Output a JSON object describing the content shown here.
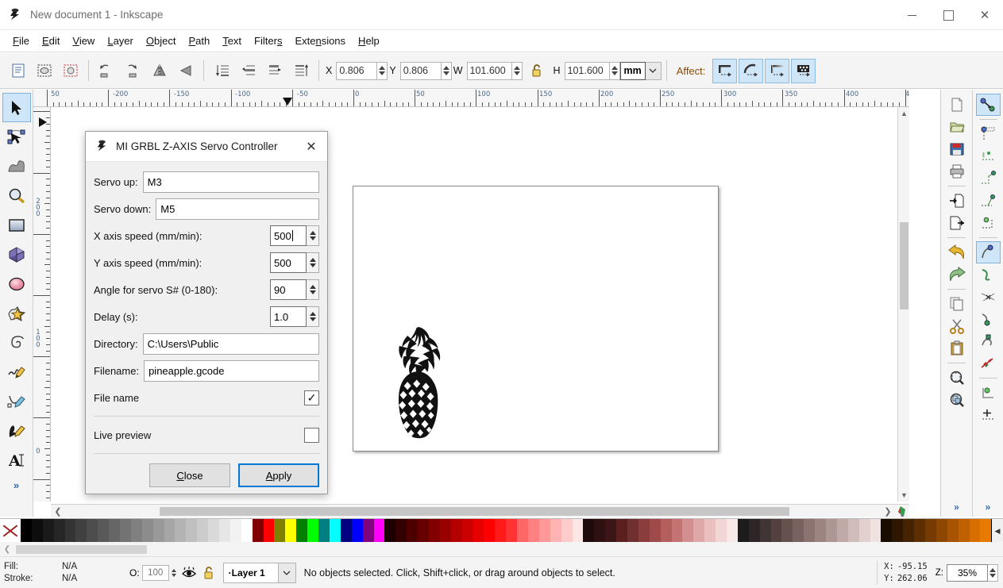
{
  "window": {
    "title": "New document 1 - Inkscape",
    "app_icon": "inkscape-logo-icon",
    "controls": {
      "minimize": "minimize-icon",
      "maximize": "maximize-icon",
      "close": "close-icon"
    }
  },
  "menubar": {
    "items": [
      {
        "label": "File",
        "mnemonic": "F"
      },
      {
        "label": "Edit",
        "mnemonic": "E"
      },
      {
        "label": "View",
        "mnemonic": "V"
      },
      {
        "label": "Layer",
        "mnemonic": "L"
      },
      {
        "label": "Object",
        "mnemonic": "O"
      },
      {
        "label": "Path",
        "mnemonic": "P"
      },
      {
        "label": "Text",
        "mnemonic": "T"
      },
      {
        "label": "Filters",
        "mnemonic": "s"
      },
      {
        "label": "Extensions",
        "mnemonic": "n"
      },
      {
        "label": "Help",
        "mnemonic": "H"
      }
    ]
  },
  "toolbar": {
    "x_label": "X",
    "x_value": "0.806",
    "y_label": "Y",
    "y_value": "0.806",
    "w_label": "W",
    "w_value": "101.600",
    "h_label": "H",
    "h_value": "101.600",
    "lock_icon": "lock-open-icon",
    "unit": "mm",
    "affect_label": "Affect:",
    "left_buttons": [
      "select-all-icon",
      "select-all-in-layers-icon",
      "deselect-icon",
      "rotate-90-ccw-icon",
      "rotate-90-cw-icon",
      "flip-horizontal-icon",
      "flip-vertical-icon",
      "lower-to-bottom-icon",
      "lower-one-step-icon",
      "raise-one-step-icon",
      "raise-to-top-icon"
    ],
    "affect_buttons": [
      "affect-stroke-width-icon",
      "affect-rounded-corners-icon",
      "affect-gradients-icon",
      "affect-patterns-icon"
    ]
  },
  "toolbox": {
    "tools": [
      {
        "name": "selector-tool",
        "icon": "arrow-cursor-icon",
        "active": true
      },
      {
        "name": "node-tool",
        "icon": "node-editor-icon",
        "active": false
      },
      {
        "name": "tweak-tool",
        "icon": "tweak-icon",
        "active": false
      },
      {
        "name": "zoom-tool",
        "icon": "magnifier-icon",
        "active": false
      },
      {
        "name": "rectangle-tool",
        "icon": "rectangle-icon",
        "active": false
      },
      {
        "name": "box3d-tool",
        "icon": "cube-icon",
        "active": false
      },
      {
        "name": "ellipse-tool",
        "icon": "ellipse-icon",
        "active": false
      },
      {
        "name": "star-tool",
        "icon": "star-icon",
        "active": false
      },
      {
        "name": "spiral-tool",
        "icon": "spiral-icon",
        "active": false
      },
      {
        "name": "pencil-tool",
        "icon": "pencil-icon",
        "active": false
      },
      {
        "name": "bezier-tool",
        "icon": "bezier-pen-icon",
        "active": false
      },
      {
        "name": "calligraphy-tool",
        "icon": "calligraphy-icon",
        "active": false
      },
      {
        "name": "text-tool",
        "icon": "text-a-icon",
        "active": false
      }
    ],
    "overflow": "»"
  },
  "rulers": {
    "horizontal": [
      "50",
      "-200",
      "-150",
      "-100",
      "-50",
      "0",
      "50",
      "100",
      "150",
      "200",
      "250",
      "300",
      "350",
      "400",
      "4"
    ],
    "vertical": [
      "2 0 0",
      "1 0 0",
      "0"
    ],
    "vertical_labels": [
      "200",
      "100",
      "0"
    ]
  },
  "canvas": {
    "page_label": "document-page",
    "artwork": "pineapple-drawing"
  },
  "dock": {
    "commands": [
      "new-document-icon",
      "open-document-icon",
      "save-document-icon",
      "print-document-icon",
      "import-icon",
      "export-icon",
      "undo-icon",
      "redo-icon",
      "copy-icon",
      "cut-icon",
      "paste-icon",
      "zoom-selection-icon",
      "zoom-drawing-icon"
    ],
    "snap": [
      {
        "name": "snap-enable",
        "icon": "snap-master-icon",
        "active": true
      },
      {
        "name": "snap-bbox",
        "icon": "snap-bbox-icon",
        "active": false
      },
      {
        "name": "snap-bbox-edge",
        "icon": "snap-bbox-edge-icon",
        "active": false
      },
      {
        "name": "snap-bbox-corner",
        "icon": "snap-bbox-corner-icon",
        "active": false
      },
      {
        "name": "snap-bbox-edge-mid",
        "icon": "snap-edge-midpoint-icon",
        "active": false
      },
      {
        "name": "snap-bbox-center",
        "icon": "snap-bbox-center-icon",
        "active": false
      },
      {
        "name": "snap-nodes",
        "icon": "snap-nodes-icon",
        "active": true
      },
      {
        "name": "snap-paths",
        "icon": "snap-path-icon",
        "active": false
      },
      {
        "name": "snap-path-intersection",
        "icon": "snap-intersection-icon",
        "active": false
      },
      {
        "name": "snap-cusp-nodes",
        "icon": "snap-cusp-node-icon",
        "active": false
      },
      {
        "name": "snap-smooth-nodes",
        "icon": "snap-smooth-node-icon",
        "active": false
      },
      {
        "name": "snap-midpoints",
        "icon": "snap-line-midpoint-icon",
        "active": false
      },
      {
        "name": "snap-object-center",
        "icon": "snap-object-center-icon",
        "active": false
      },
      {
        "name": "snap-rotation-center",
        "icon": "snap-rotation-center-icon",
        "active": false
      }
    ],
    "overflow": "»"
  },
  "dialog": {
    "icon": "inkscape-logo-icon",
    "title": "MI GRBL Z-AXIS Servo Controller",
    "close_icon": "close-icon",
    "fields": [
      {
        "label": "Servo up:",
        "value": "M3",
        "type": "text"
      },
      {
        "label": "Servo down:",
        "value": "M5",
        "type": "text"
      },
      {
        "label": "X axis speed (mm/min):",
        "value": "500",
        "type": "spin",
        "focused": true
      },
      {
        "label": "Y axis speed (mm/min):",
        "value": "500",
        "type": "spin"
      },
      {
        "label": "Angle for servo S# (0-180):",
        "value": "90",
        "type": "spin"
      },
      {
        "label": "Delay (s):",
        "value": "1.0",
        "type": "spin"
      },
      {
        "label": "Directory:",
        "value": "C:\\Users\\Public",
        "type": "text"
      },
      {
        "label": "Filename:",
        "value": "pineapple.gcode",
        "type": "text"
      }
    ],
    "file_name_label": "File name",
    "file_name_checked": true,
    "file_name_check_glyph": "✓",
    "live_preview_label": "Live preview",
    "live_preview_checked": false,
    "close_button": "Close",
    "close_button_mnemonic": "C",
    "apply_button": "Apply",
    "apply_button_mnemonic": "A"
  },
  "statusbar": {
    "fill_label": "Fill:",
    "stroke_label": "Stroke:",
    "fill_value": "N/A",
    "stroke_value": "N/A",
    "opacity_label": "O:",
    "opacity_value": "100",
    "visibility_icon": "eye-icon",
    "lock_icon": "lock-open-icon",
    "layer_name": "Layer 1",
    "layer_bullet": "·",
    "message": "No objects selected. Click, Shift+click, or drag around objects to select.",
    "coord_x_label": "X:",
    "coord_x_value": "-95.15",
    "coord_y_label": "Y:",
    "coord_y_value": "262.06",
    "zoom_label": "Z:",
    "zoom_value": "35%"
  },
  "palette": {
    "none_swatch": "no-color-icon",
    "scroll_arrow": "◀",
    "colors": [
      "#000000",
      "#0d0d0d",
      "#1a1a1a",
      "#262626",
      "#333333",
      "#404040",
      "#4d4d4d",
      "#595959",
      "#666666",
      "#737373",
      "#808080",
      "#8c8c8c",
      "#999999",
      "#a6a6a6",
      "#b3b3b3",
      "#bfbfbf",
      "#cccccc",
      "#d9d9d9",
      "#e6e6e6",
      "#f2f2f2",
      "#ffffff",
      "#800000",
      "#ff0000",
      "#808000",
      "#ffff00",
      "#008000",
      "#00ff00",
      "#008080",
      "#00ffff",
      "#000080",
      "#0000ff",
      "#800080",
      "#ff00ff",
      "#1a0000",
      "#330000",
      "#4d0000",
      "#660000",
      "#800000",
      "#990000",
      "#b30000",
      "#cc0000",
      "#e60000",
      "#ff0000",
      "#ff1a1a",
      "#ff3333",
      "#ff6666",
      "#ff8080",
      "#ff9999",
      "#ffb3b3",
      "#ffcccc",
      "#ffe6e6",
      "#1e0a0a",
      "#2d1010",
      "#3c1616",
      "#5a2020",
      "#713030",
      "#8b3c3c",
      "#a04b4b",
      "#b55e5e",
      "#c47373",
      "#d28f8f",
      "#dfa8a8",
      "#e9c0c0",
      "#f1d6d6",
      "#f8e8e8",
      "#1c1c1c",
      "#2e2626",
      "#413434",
      "#53403f",
      "#65514e",
      "#78625f",
      "#8a7370",
      "#9c8481",
      "#ad9794",
      "#bfaaa7",
      "#d0bdba",
      "#e1d0ce",
      "#efe3e1",
      "#1a0d00",
      "#2e1700",
      "#452200",
      "#5c2e00",
      "#753b00",
      "#8d4700",
      "#a65400",
      "#bf6100",
      "#d86e00",
      "#e87a00"
    ]
  }
}
